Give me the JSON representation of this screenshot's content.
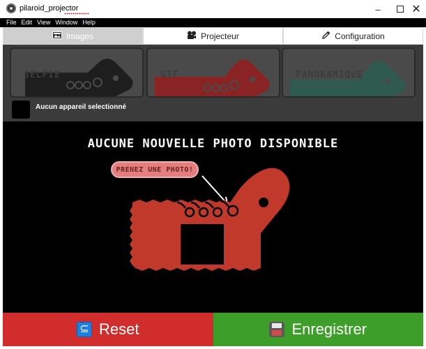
{
  "window": {
    "title": "pilaroid_projector",
    "minimize": "–",
    "close": "✕"
  },
  "menu": [
    "File",
    "Edit",
    "View",
    "Window",
    "Help"
  ],
  "tabs": [
    {
      "label": "Images",
      "icon": "image-icon",
      "active": true
    },
    {
      "label": "Projecteur",
      "icon": "projector-icon",
      "active": false
    },
    {
      "label": "Configuration",
      "icon": "pencil-icon",
      "active": false
    }
  ],
  "modes": [
    {
      "label": "SELFIE",
      "color": "#1e1e1e"
    },
    {
      "label": "GIF",
      "color": "#8a2424"
    },
    {
      "label": "PANORAMIQUE",
      "color": "#2f5a50"
    }
  ],
  "device": {
    "status": "Aucun appareil selectionné"
  },
  "main": {
    "title": "AUCUNE NOUVELLE PHOTO DISPONIBLE",
    "hint": "PRENEZ UNE PHOTO!",
    "camera_color": "#c0392b"
  },
  "buttons": {
    "reset": "Reset",
    "save": "Enregistrer",
    "reset_color": "#d12d2d",
    "save_color": "#3d9e2a"
  }
}
